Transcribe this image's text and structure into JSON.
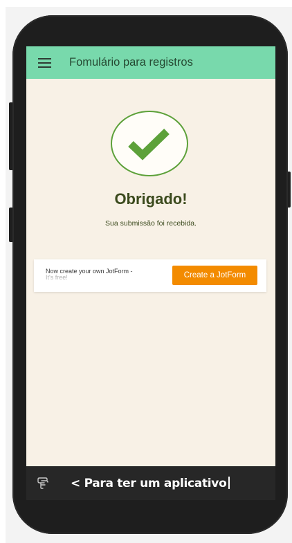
{
  "app_bar": {
    "title": "Fomulário para registros",
    "menu_icon": "hamburger-menu-icon"
  },
  "confirmation": {
    "icon": "checkmark-icon",
    "heading": "Obrigado!",
    "message": "Sua submissão foi recebida."
  },
  "promo": {
    "text_line1": "Now create your own JotForm -",
    "text_line2": "It's free!",
    "button_label": "Create a JotForm"
  },
  "bottom_bar": {
    "icon": "form-app-icon",
    "text": "< Para ter um aplicativo"
  },
  "colors": {
    "app_bar": "#78d9ac",
    "screen_background": "#f8f1e6",
    "check_green": "#5da13a",
    "heading_text": "#3b4a1d",
    "promo_button": "#f38b00",
    "bottom_bar": "#272727",
    "phone_frame": "#1e1e1e"
  }
}
